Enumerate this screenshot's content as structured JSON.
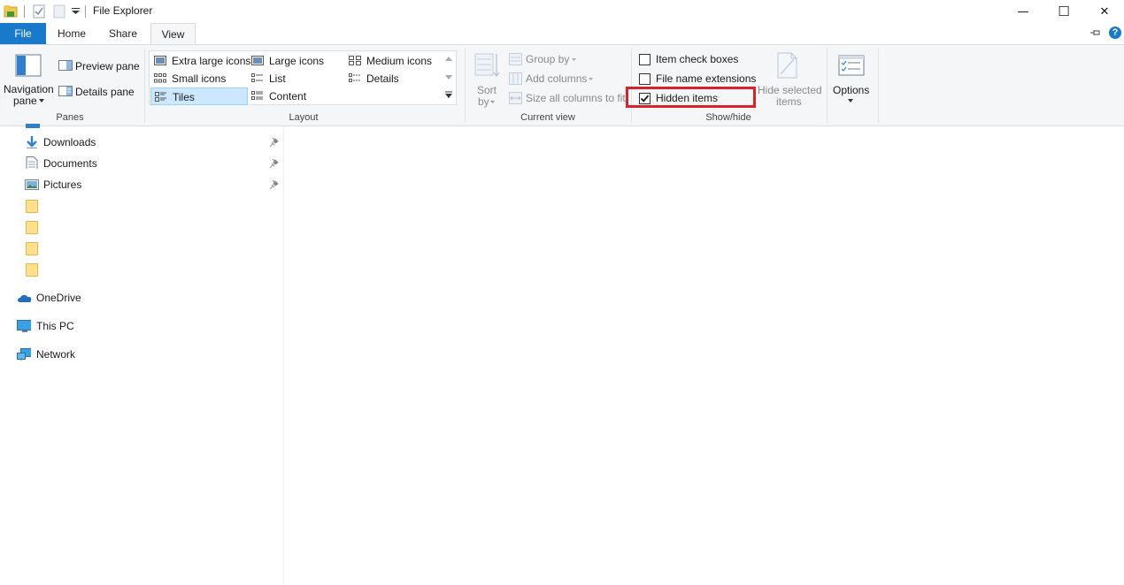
{
  "window": {
    "title": "File Explorer",
    "minimize_glyph": "—",
    "maximize_glyph": "☐",
    "close_glyph": "✕",
    "help_glyph": "?"
  },
  "tabs": {
    "file": "File",
    "home": "Home",
    "share": "Share",
    "view": "View"
  },
  "ribbon": {
    "panes": {
      "navigation_pane_line1": "Navigation",
      "navigation_pane_line2": "pane",
      "preview_pane": "Preview pane",
      "details_pane": "Details pane",
      "group_label": "Panes"
    },
    "layout": {
      "items": [
        "Extra large icons",
        "Large icons",
        "Medium icons",
        "Small icons",
        "List",
        "Details",
        "Tiles",
        "Content"
      ],
      "selected": "Tiles",
      "group_label": "Layout"
    },
    "current_view": {
      "sort_line1": "Sort",
      "sort_line2": "by",
      "group_by": "Group by",
      "add_columns": "Add columns",
      "size_all_columns": "Size all columns to fit",
      "group_label": "Current view"
    },
    "show_hide": {
      "item_check_boxes": "Item check boxes",
      "item_check_boxes_checked": false,
      "file_name_extensions": "File name extensions",
      "file_name_extensions_checked": false,
      "hidden_items": "Hidden items",
      "hidden_items_checked": true,
      "hide_selected_line1": "Hide selected",
      "hide_selected_line2": "items",
      "group_label": "Show/hide"
    },
    "options": {
      "label": "Options"
    }
  },
  "nav": {
    "downloads": "Downloads",
    "documents": "Documents",
    "pictures": "Pictures",
    "onedrive": "OneDrive",
    "this_pc": "This PC",
    "network": "Network"
  },
  "colors": {
    "accent": "#1979ca",
    "highlight": "#d9222b",
    "selected_bg": "#cce8ff",
    "folder": "#ffe08a"
  }
}
